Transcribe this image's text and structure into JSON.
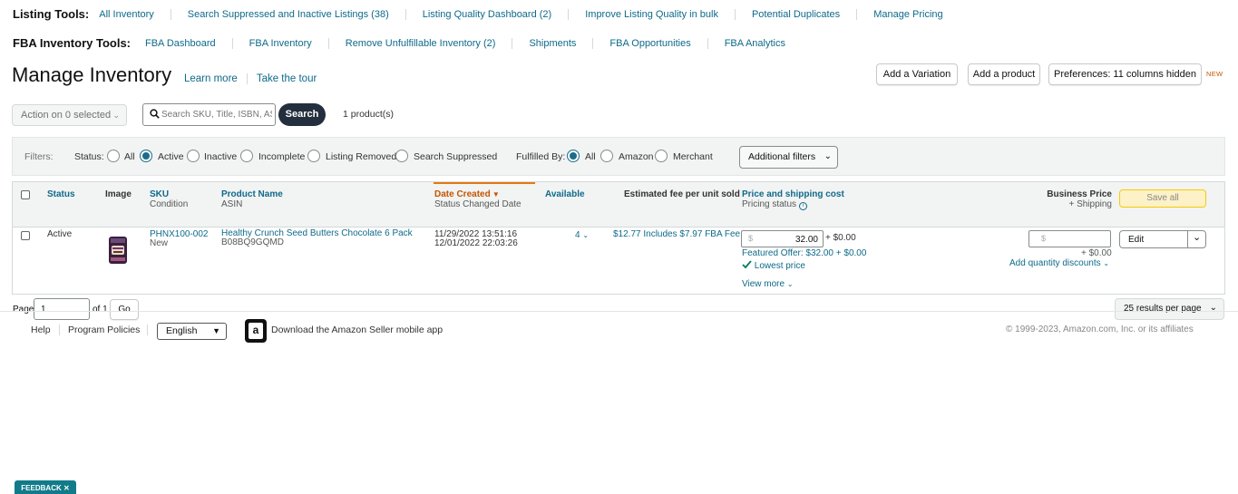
{
  "listing_tools": {
    "label": "Listing Tools:",
    "links": [
      "All Inventory",
      "Search Suppressed and Inactive Listings (38)",
      "Listing Quality Dashboard (2)",
      "Improve Listing Quality in bulk",
      "Potential Duplicates",
      "Manage Pricing"
    ]
  },
  "fba_tools": {
    "label": "FBA Inventory Tools:",
    "links": [
      "FBA Dashboard",
      "FBA Inventory",
      "Remove Unfulfillable Inventory (2)",
      "Shipments",
      "FBA Opportunities",
      "FBA Analytics"
    ]
  },
  "header": {
    "title": "Manage Inventory",
    "learn_more": "Learn more",
    "take_tour": "Take the tour",
    "add_variation": "Add a Variation",
    "add_product": "Add a product",
    "preferences": "Preferences: 11 columns hidden",
    "new_badge": "NEW"
  },
  "toolbar": {
    "action": "Action on 0 selected",
    "search_placeholder": "Search SKU, Title, ISBN, ASIN",
    "search_button": "Search",
    "product_count": "1 product(s)"
  },
  "filters": {
    "label": "Filters:",
    "status_label": "Status:",
    "status_options": [
      "All",
      "Active",
      "Inactive",
      "Incomplete",
      "Listing Removed",
      "Search Suppressed"
    ],
    "status_selected": "Active",
    "fulfilled_label": "Fulfilled By:",
    "fulfilled_options": [
      "All",
      "Amazon",
      "Merchant"
    ],
    "fulfilled_selected": "All",
    "additional": "Additional filters"
  },
  "table": {
    "headers": {
      "status": "Status",
      "image": "Image",
      "sku": "SKU",
      "condition": "Condition",
      "product_name": "Product Name",
      "asin": "ASIN",
      "date_created": "Date Created",
      "status_changed": "Status Changed Date",
      "available": "Available",
      "est_fee": "Estimated fee per unit sold",
      "price_shipping": "Price and shipping cost",
      "pricing_status": "Pricing status",
      "business_price": "Business Price",
      "plus_shipping": "+ Shipping",
      "save_all": "Save all"
    },
    "row": {
      "status": "Active",
      "sku": "PHNX100-002",
      "condition": "New",
      "product_name": "Healthy Crunch Seed Butters Chocolate 6 Pack",
      "asin": "B08BQ9GQMD",
      "date_created": "11/29/2022 13:51:16",
      "status_changed": "12/01/2022 22:03:26",
      "available": "4",
      "est_fee": "$12.77 Includes $7.97 FBA Fee",
      "price_currency": "$",
      "price": "32.00",
      "shipping": "+ $0.00",
      "featured_offer": "Featured Offer: $32.00 + $0.00",
      "lowest_price": "Lowest price",
      "view_more": "View more",
      "biz_currency": "$",
      "biz_shipping": "+ $0.00",
      "qty_discounts": "Add quantity discounts",
      "edit": "Edit"
    }
  },
  "pagination": {
    "page_label": "Page",
    "page_value": "1",
    "of_label": "of 1",
    "go": "Go",
    "per_page": "25 results per page"
  },
  "footer": {
    "help": "Help",
    "program_policies": "Program Policies",
    "language": "English",
    "app_text": "Download the Amazon Seller mobile app",
    "copyright": "© 1999-2023, Amazon.com, Inc. or its affiliates"
  },
  "feedback": "FEEDBACK",
  "colors": {
    "link": "#0e6a8a",
    "accent_orange": "#c45500",
    "dark_button": "#232f3e",
    "save_yellow": "#fdf1c7",
    "feedback_teal": "#117b8a"
  }
}
